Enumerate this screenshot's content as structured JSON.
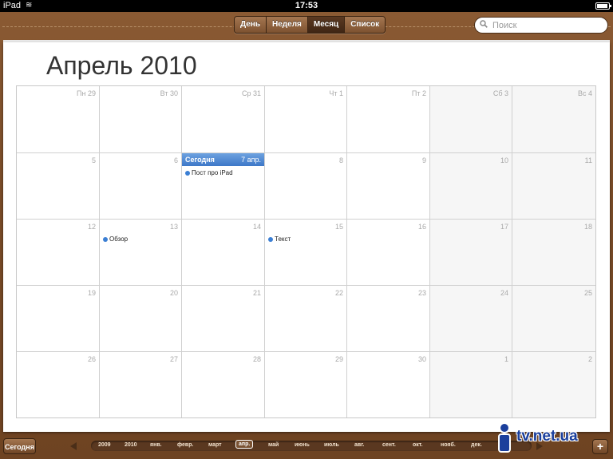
{
  "statusbar": {
    "carrier": "iPad",
    "time": "17:53"
  },
  "views": [
    {
      "label": "День",
      "active": false
    },
    {
      "label": "Неделя",
      "active": false
    },
    {
      "label": "Месяц",
      "active": true
    },
    {
      "label": "Список",
      "active": false
    }
  ],
  "search": {
    "placeholder": "Поиск"
  },
  "month_title": "Апрель 2010",
  "today": {
    "label": "Сегодня",
    "date": "7 апр."
  },
  "weeks": [
    [
      "Пн 29",
      "Вт 30",
      "Ср 31",
      "Чт 1",
      "Пт 2",
      "Сб 3",
      "Вс 4"
    ],
    [
      "5",
      "6",
      "7",
      "8",
      "9",
      "10",
      "11"
    ],
    [
      "12",
      "13",
      "14",
      "15",
      "16",
      "17",
      "18"
    ],
    [
      "19",
      "20",
      "21",
      "22",
      "23",
      "24",
      "25"
    ],
    [
      "26",
      "27",
      "28",
      "29",
      "30",
      "1",
      "2"
    ]
  ],
  "events": {
    "post_ipad": "Пост про  iPad",
    "review": "Обзор",
    "text": "Текст"
  },
  "bottom": {
    "today_button": "Сегодня",
    "timeline": [
      "2009",
      "2010",
      "янв.",
      "февр.",
      "март",
      "апр.",
      "май",
      "июнь",
      "июль",
      "авг.",
      "сент.",
      "окт.",
      "нояб.",
      "дек."
    ],
    "timeline_selected": "апр.",
    "add_button": "+"
  },
  "watermark": {
    "text": "tv.net.ua"
  },
  "colors": {
    "leather": "#7a4c28",
    "today_bar": "#3d78c8",
    "event_dot": "#3b7fd4"
  }
}
